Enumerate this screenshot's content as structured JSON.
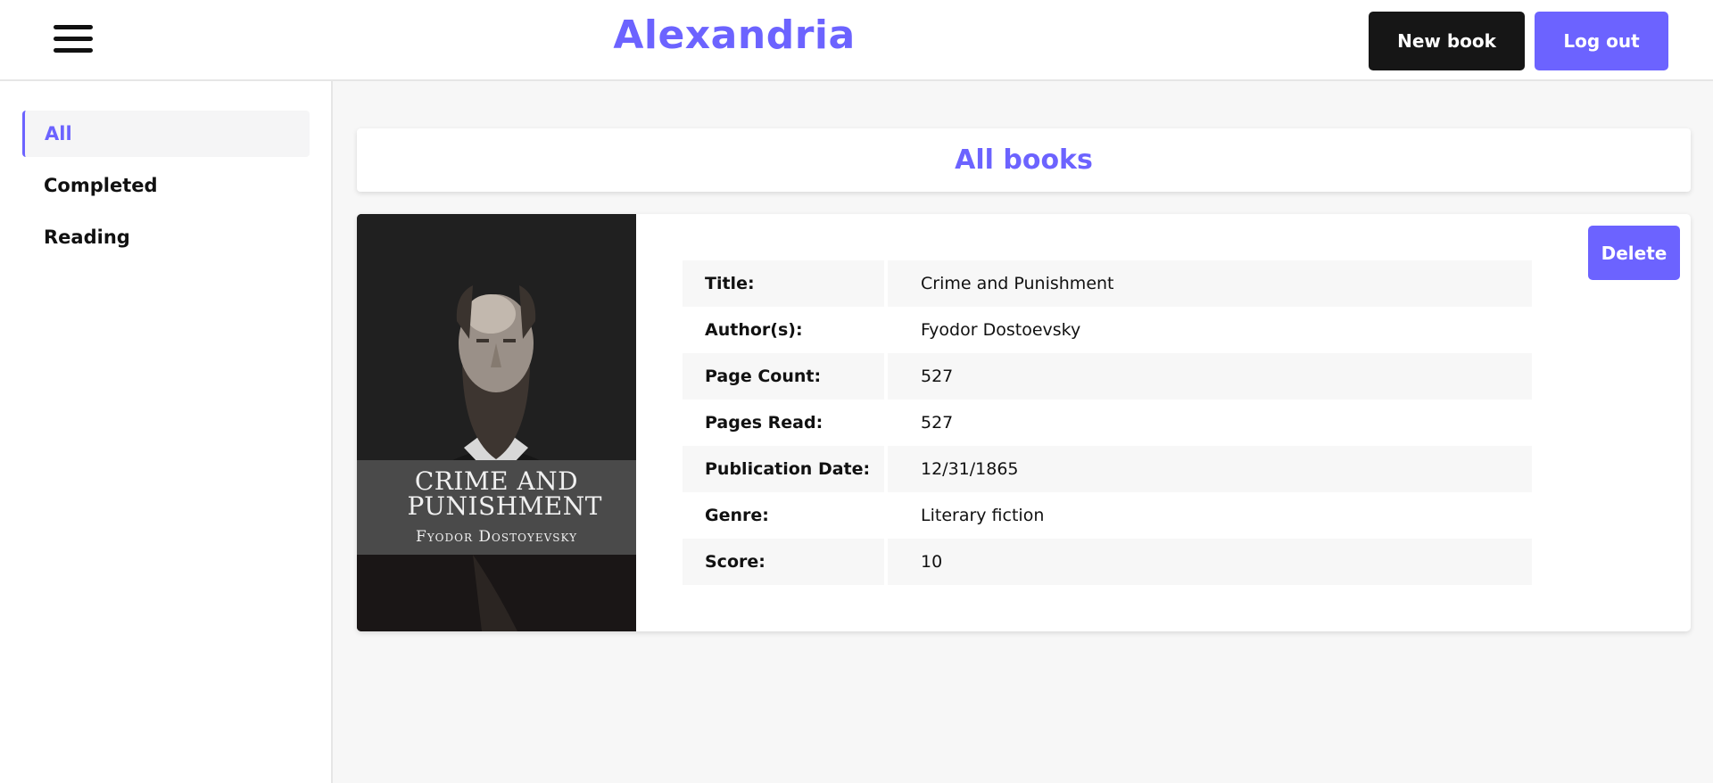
{
  "header": {
    "brand": "Alexandria",
    "new_book_label": "New book",
    "logout_label": "Log out",
    "menu_icon": "hamburger-menu-icon",
    "accent_color": "#6c63ff",
    "dark_button_color": "#161616"
  },
  "sidebar": {
    "items": [
      {
        "label": "All",
        "active": true
      },
      {
        "label": "Completed",
        "active": false
      },
      {
        "label": "Reading",
        "active": false
      }
    ]
  },
  "main": {
    "section_title": "All books",
    "book": {
      "cover": {
        "title": "CRIME AND PUNISHMENT",
        "author": "Fyodor Dostoyevsky"
      },
      "delete_label": "Delete",
      "fields": [
        {
          "label": "Title:",
          "value": "Crime and Punishment"
        },
        {
          "label": "Author(s):",
          "value": "Fyodor Dostoevsky"
        },
        {
          "label": "Page Count:",
          "value": "527"
        },
        {
          "label": "Pages Read:",
          "value": "527"
        },
        {
          "label": "Publication Date:",
          "value": "12/31/1865"
        },
        {
          "label": "Genre:",
          "value": "Literary fiction"
        },
        {
          "label": "Score:",
          "value": "10"
        }
      ]
    }
  }
}
